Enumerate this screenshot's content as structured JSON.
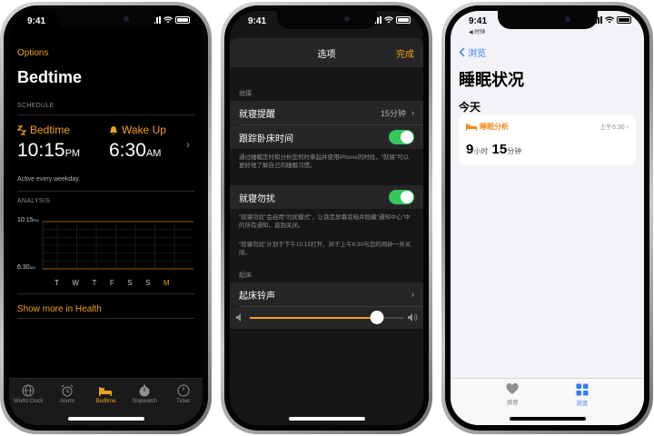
{
  "colors": {
    "accent_orange": "#f0a019",
    "health_blue": "#2f7cf6",
    "toggle_green": "#34c759"
  },
  "status_time": "9:41",
  "clock": {
    "back_label": "Options",
    "title": "Bedtime",
    "schedule_header": "SCHEDULE",
    "bedtime_label": "Bedtime",
    "bedtime_time": "10:15",
    "bedtime_ampm": "PM",
    "wakeup_label": "Wake Up",
    "wakeup_time": "6:30",
    "wakeup_ampm": "AM",
    "active_note": "Active every weekday.",
    "analysis_header": "ANALYSIS",
    "chart_start_label": "10:15",
    "chart_start_suffix": "PM",
    "chart_end_label": "6:30",
    "chart_end_suffix": "AM",
    "days": [
      "T",
      "W",
      "T",
      "F",
      "S",
      "S",
      "M"
    ],
    "health_link": "Show more in Health",
    "tabs": [
      {
        "label": "World Clock",
        "icon": "globe-icon"
      },
      {
        "label": "Alarm",
        "icon": "alarm-clock-icon"
      },
      {
        "label": "Bedtime",
        "icon": "bed-icon"
      },
      {
        "label": "Stopwatch",
        "icon": "stopwatch-icon"
      },
      {
        "label": "Timer",
        "icon": "timer-icon"
      }
    ]
  },
  "options": {
    "title": "选项",
    "done": "完成",
    "section_bedtime": "就寝",
    "reminder_label": "就寝提醒",
    "reminder_value": "15分钟",
    "track_label": "跟踪卧床时间",
    "track_on": true,
    "track_footer": "通过睡眠定时和分析您何时拿起并使用iPhone的时段，“就寝”可以更好地了解自己的睡眠习惯。",
    "dnd_label": "就寝勿扰",
    "dnd_on": true,
    "dnd_footer": "“就寝勿扰”会启用“勿扰模式”，让锁定屏幕变暗并隐藏“通知中心”中的所有通知，直到关闭。",
    "dnd_schedule_note": "“就寝勿扰”计划于下午10:15打开，并于上午6:30与您的闹钟一并关闭。",
    "section_wake": "起床",
    "sound_label": "起床铃声",
    "volume_level": 0.83
  },
  "health": {
    "sub_status": "◀ 时钟",
    "back_label": "浏览",
    "title": "睡眠状况",
    "today": "今天",
    "card_title": "睡眠分析",
    "card_time": "上午6:30",
    "hours": "9",
    "hours_unit": "小时",
    "minutes": "15",
    "minutes_unit": "分钟",
    "tabs": [
      {
        "label": "摘要",
        "icon": "heart-icon"
      },
      {
        "label": "浏览",
        "icon": "grid-icon"
      }
    ]
  }
}
